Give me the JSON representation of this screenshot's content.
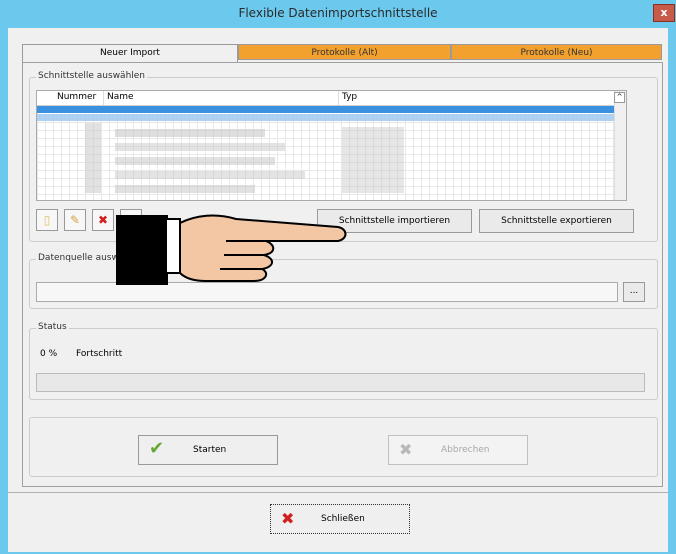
{
  "window": {
    "title": "Flexible Datenimportschnittstelle",
    "close_label": "x"
  },
  "tabs": [
    {
      "label": "Neuer Import"
    },
    {
      "label": "Protokolle (Alt)"
    },
    {
      "label": "Protokolle (Neu)"
    }
  ],
  "interface_group": {
    "legend": "Schnittstelle auswählen",
    "columns": [
      "Nummer",
      "Name",
      "Typ"
    ],
    "import_button": "Schnittstelle importieren",
    "export_button": "Schnittstelle exportieren"
  },
  "datasource_group": {
    "legend": "Datenquelle auswählen",
    "path_value": "",
    "browse_label": "..."
  },
  "status_group": {
    "legend": "Status",
    "percent": "0 %",
    "progress_label": "Fortschritt",
    "progress_value": 0
  },
  "actions": {
    "start_label": "Starten",
    "cancel_label": "Abbrechen"
  },
  "footer": {
    "close_label": "Schließen"
  },
  "colors": {
    "titlebar": "#6cc9ee",
    "tab_inactive": "#f2a12e",
    "selection": "#3b90e0",
    "window_bg": "#f0f0f0"
  }
}
